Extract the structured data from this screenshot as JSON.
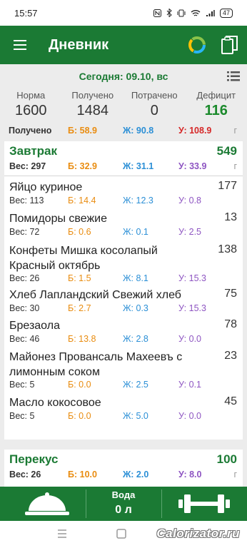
{
  "status": {
    "time": "15:57",
    "signal": "▮",
    "battery": "47"
  },
  "appbar": {
    "title": "Дневник"
  },
  "summary": {
    "date": "Сегодня: 09.10, вс",
    "labels": [
      "Норма",
      "Получено",
      "Потрачено",
      "Дефицит"
    ],
    "values": [
      "1600",
      "1484",
      "0",
      "116"
    ],
    "macros": {
      "label": "Получено",
      "b": "Б: 58.9",
      "zh": "Ж: 90.8",
      "u": "У: 108.9",
      "unit": "г"
    }
  },
  "meals": [
    {
      "name": "Завтрак",
      "kcal": "549",
      "weight": "Вес: 297",
      "b": "Б: 32.9",
      "zh": "Ж: 31.1",
      "u": "У: 33.9",
      "unit": "г",
      "items": [
        {
          "name": "Яйцо куриное",
          "kcal": "177",
          "weight": "Вес: 113",
          "b": "Б: 14.4",
          "zh": "Ж: 12.3",
          "u": "У: 0.8"
        },
        {
          "name": "Помидоры свежие",
          "kcal": "13",
          "weight": "Вес: 72",
          "b": "Б: 0.6",
          "zh": "Ж: 0.1",
          "u": "У: 2.5"
        },
        {
          "name": "Конфеты Мишка косолапый Красный октябрь",
          "kcal": "138",
          "weight": "Вес: 26",
          "b": "Б: 1.5",
          "zh": "Ж: 8.1",
          "u": "У: 15.3"
        },
        {
          "name": "Хлеб Лапландский Свежий хлеб",
          "kcal": "75",
          "weight": "Вес: 30",
          "b": "Б: 2.7",
          "zh": "Ж: 0.3",
          "u": "У: 15.3"
        },
        {
          "name": "Брезаола",
          "kcal": "78",
          "weight": "Вес: 46",
          "b": "Б: 13.8",
          "zh": "Ж: 2.8",
          "u": "У: 0.0"
        },
        {
          "name": "Майонез Провансаль Махеевъ с лимонным соком",
          "kcal": "23",
          "weight": "Вес: 5",
          "b": "Б: 0.0",
          "zh": "Ж: 2.5",
          "u": "У: 0.1"
        },
        {
          "name": "Масло кокосовое",
          "kcal": "45",
          "weight": "Вес: 5",
          "b": "Б: 0.0",
          "zh": "Ж: 5.0",
          "u": "У: 0.0"
        }
      ]
    },
    {
      "name": "Перекус",
      "kcal": "100",
      "weight": "Вес: 26",
      "b": "Б: 10.0",
      "zh": "Ж: 2.0",
      "u": "У: 8.0",
      "unit": "г"
    }
  ],
  "water": {
    "label": "Вода",
    "value": "0 л"
  },
  "watermark": "Calorizator.ru",
  "icons": [
    "menu-icon",
    "progress-ring-icon",
    "clipboard-icon",
    "list-icon",
    "food-cloche-icon",
    "dumbbell-icon"
  ],
  "colors": {
    "primary": "#1b7a34",
    "protein": "#e98c10",
    "fat": "#2b8fd6",
    "carbs": "#8e55c2",
    "carbs_over": "#d62828"
  }
}
